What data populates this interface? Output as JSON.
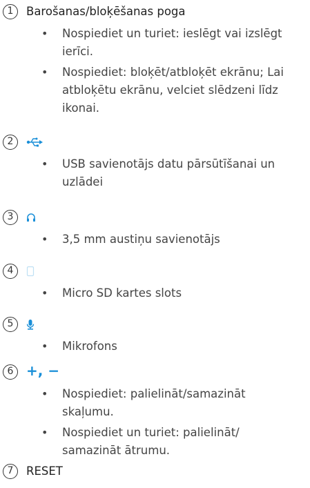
{
  "items": [
    {
      "number": "1",
      "title": "Barošanas/bloķēšanas poga",
      "bullets": [
        "Nospiediet un turiet: ieslēgt vai izslēgt ierīci.",
        "Nospiediet: bloķēt/atbloķēt ekrānu; Lai atbloķētu ekrānu, velciet slēdzeni līdz ikonai."
      ]
    },
    {
      "number": "2",
      "icon": "usb-icon",
      "bullets": [
        "USB savienotājs datu pārsūtīšanai un uzlādei"
      ]
    },
    {
      "number": "3",
      "icon": "headphones-icon",
      "bullets": [
        "3,5 mm austiņu savienotājs"
      ]
    },
    {
      "number": "4",
      "icon": "sd-card-icon",
      "bullets": [
        "Micro SD kartes slots"
      ]
    },
    {
      "number": "5",
      "icon": "microphone-icon",
      "bullets": [
        "Mikrofons"
      ]
    },
    {
      "number": "6",
      "symbols": "+, −",
      "bullets": [
        "Nospiediet: palielināt/samazināt skaļumu.",
        "Nospiediet un turiet: palielināt/ samazināt ātrumu."
      ]
    },
    {
      "number": "7",
      "title": "RESET"
    }
  ],
  "bullet_char": "•",
  "colors": {
    "accent": "#1a8fd8",
    "text": "#444444"
  }
}
